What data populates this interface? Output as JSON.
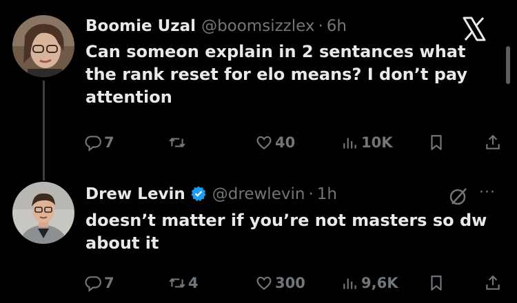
{
  "tweets": [
    {
      "author_name": "Boomie Uzal",
      "handle": "@boomsizzlex",
      "separator": "·",
      "time": "6h",
      "text": "Can someon explain in 2 sentances what the rank reset for elo means? I don’t pay attention",
      "replies": "7",
      "retweets": "",
      "likes": "40",
      "views": "10K"
    },
    {
      "author_name": "Drew Levin",
      "handle": "@drewlevin",
      "separator": "·",
      "time": "1h",
      "text": "doesn’t matter if you’re not masters so dw about it",
      "replies": "7",
      "retweets": "4",
      "likes": "300",
      "views": "9,6K"
    }
  ],
  "more_menu": "···",
  "colors": {
    "background": "#000000",
    "text": "#e7e9ea",
    "muted": "#71767b",
    "verified": "#1d9bf0"
  },
  "icons": [
    "reply-icon",
    "retweet-icon",
    "heart-icon",
    "views-icon",
    "bookmark-icon",
    "share-icon",
    "x-logo",
    "verified-badge-icon",
    "grok-icon"
  ]
}
